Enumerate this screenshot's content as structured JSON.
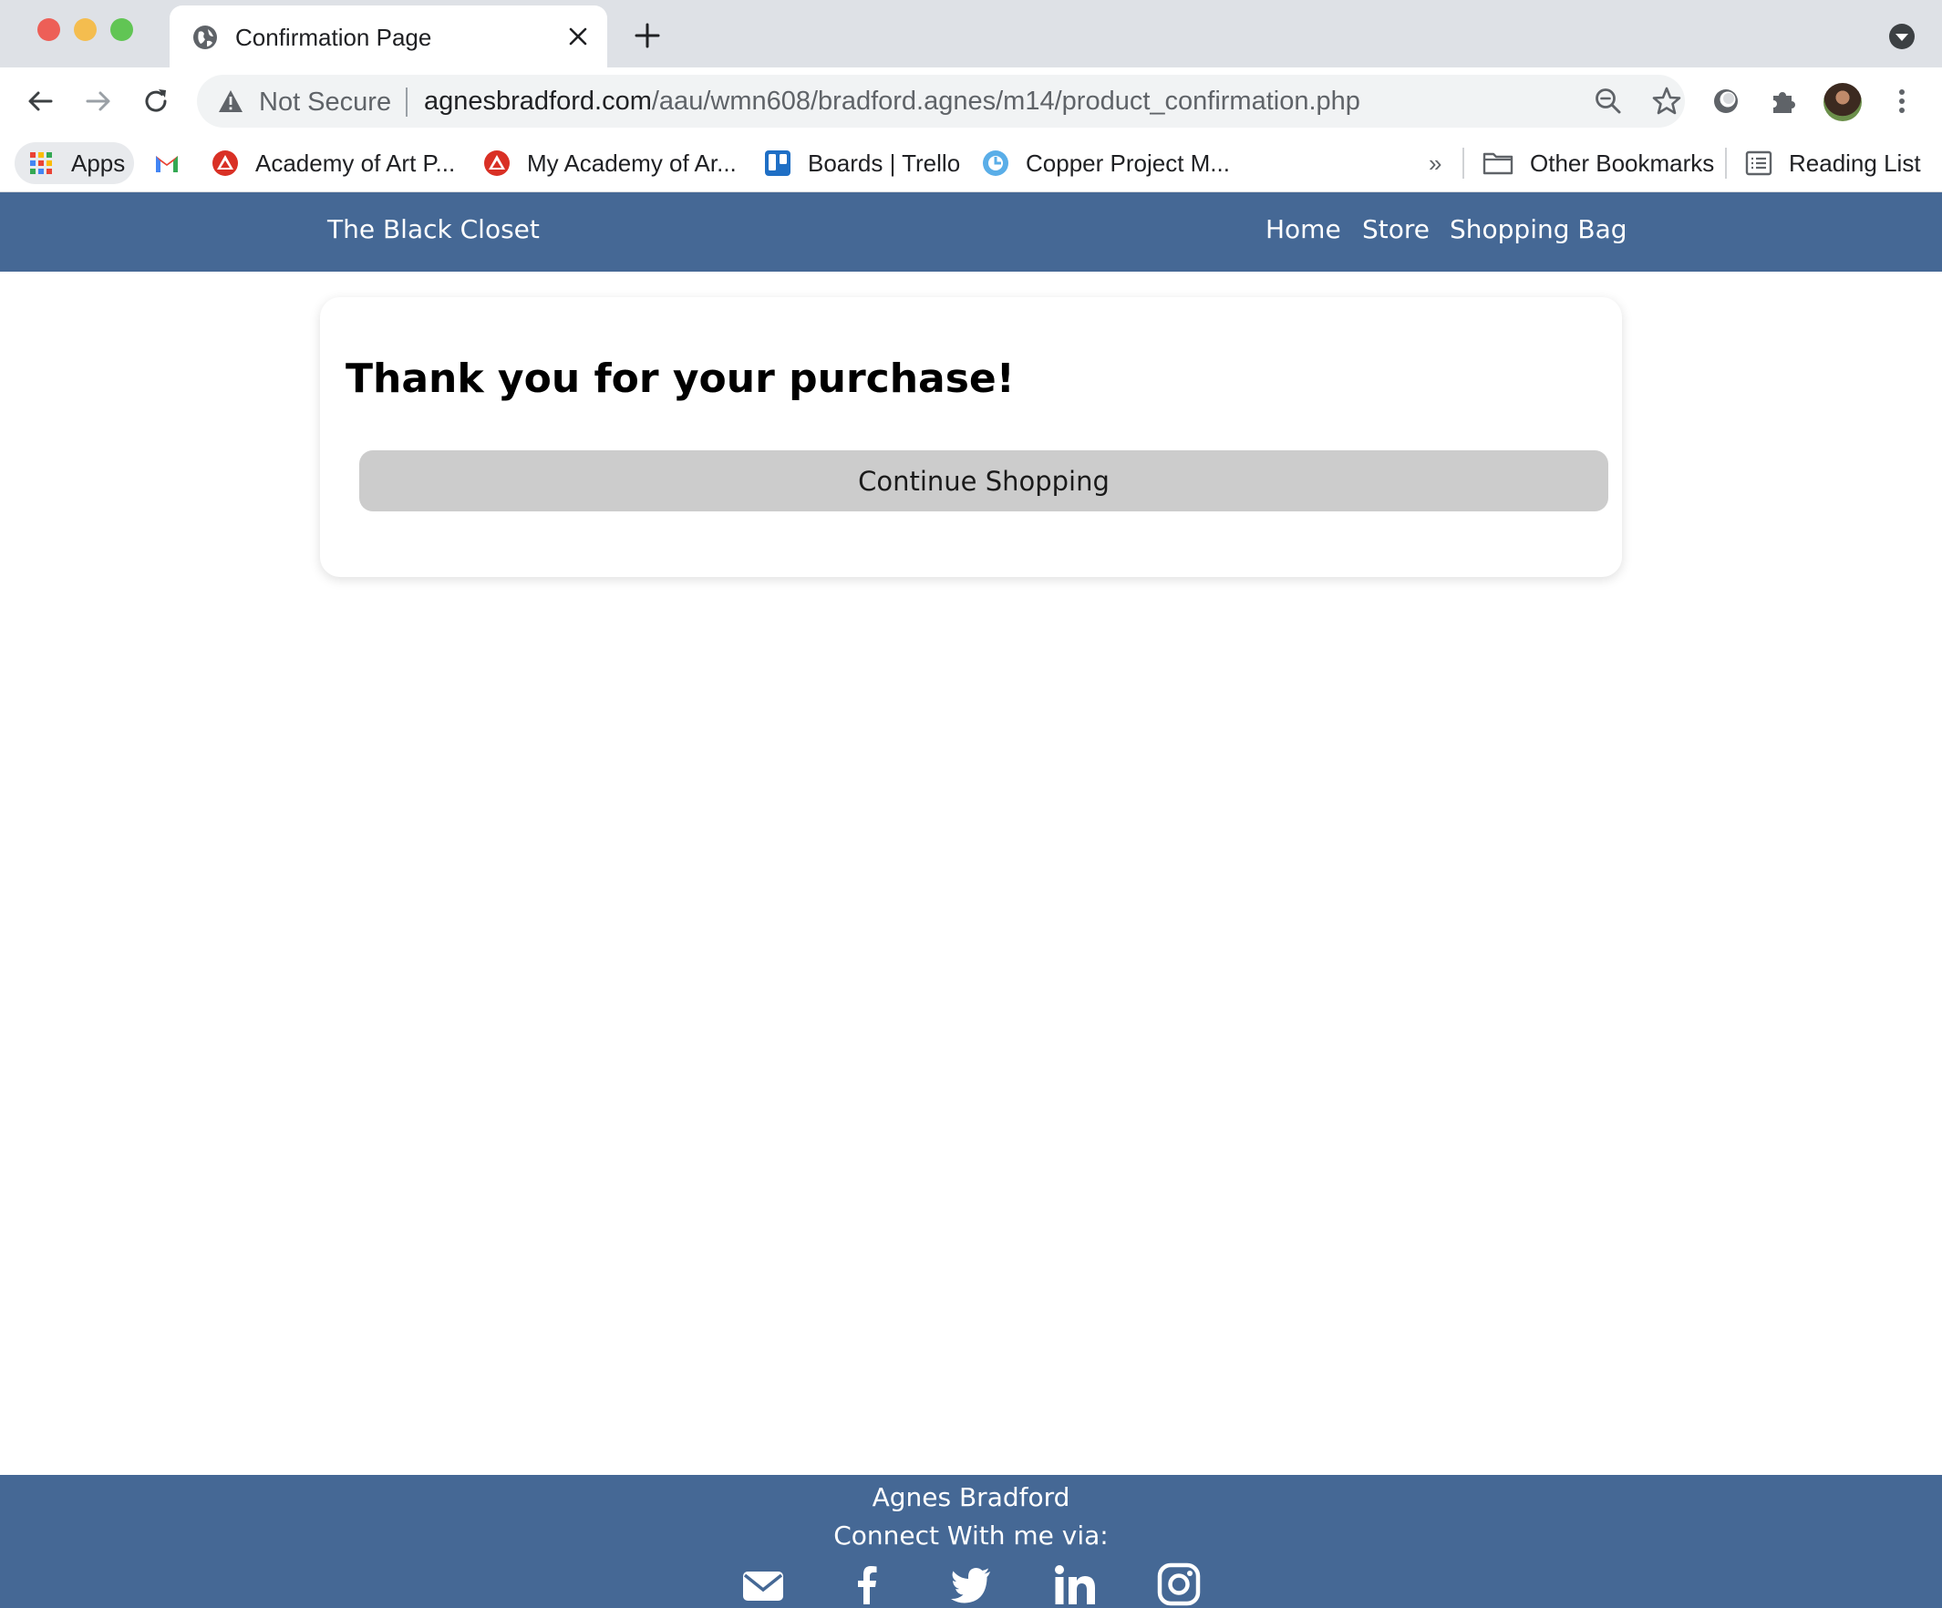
{
  "browser": {
    "tab_title": "Confirmation Page",
    "address": {
      "security_label": "Not Secure",
      "url_host": "agnesbradford.com",
      "url_path": "/aau/wmn608/bradford.agnes/m14/product_confirmation.php"
    },
    "bookmarks": [
      {
        "label": "Apps",
        "icon": "apps-grid-icon"
      },
      {
        "label": "",
        "icon": "gmail-icon"
      },
      {
        "label": "Academy of Art P...",
        "icon": "academy-icon"
      },
      {
        "label": "My Academy of Ar...",
        "icon": "academy-icon"
      },
      {
        "label": "Boards | Trello",
        "icon": "trello-icon"
      },
      {
        "label": "Copper Project M...",
        "icon": "copper-icon"
      }
    ],
    "overflow_label": "»",
    "other_bookmarks_label": "Other Bookmarks",
    "reading_list_label": "Reading List"
  },
  "site": {
    "brand": "The Black Closet",
    "nav": [
      {
        "label": "Home"
      },
      {
        "label": "Store"
      },
      {
        "label": "Shopping Bag"
      }
    ],
    "heading": "Thank you for your purchase!",
    "cta_label": "Continue Shopping",
    "footer": {
      "name": "Agnes Bradford",
      "connect": "Connect With me via:",
      "social": [
        "envelope-icon",
        "facebook-icon",
        "twitter-icon",
        "linkedin-icon",
        "instagram-icon"
      ]
    }
  },
  "colors": {
    "header_blue": "#456895",
    "button_gray": "#cccccc"
  }
}
